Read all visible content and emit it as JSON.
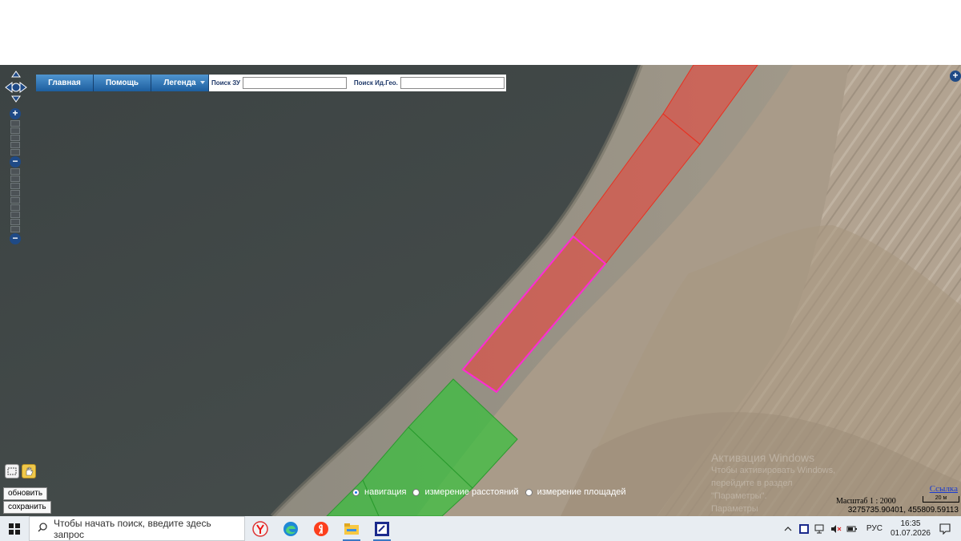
{
  "toolbar": {
    "main_label": "Главная",
    "help_label": "Помощь",
    "legend_label": "Легенда",
    "search_zu_label": "Поиск ЗУ",
    "search_zu_value": "",
    "search_geo_label": "Поиск Ид.Гео.",
    "search_geo_value": ""
  },
  "controls": {
    "zoom_in": "+",
    "zoom_out": "−",
    "zoom_mid": "−",
    "add_layer": "+"
  },
  "actions": {
    "refresh_label": "обновить",
    "save_label": "сохранить"
  },
  "modes": {
    "items": [
      {
        "label": "навигация",
        "selected": true
      },
      {
        "label": "измерение расстояний",
        "selected": false
      },
      {
        "label": "измерение площадей",
        "selected": false
      }
    ]
  },
  "watermark": {
    "line1": "Активация Windows",
    "line2": "Чтобы активировать Windows, перейдите в раздел \"Параметры\".",
    "line3": "Параметры"
  },
  "map_info": {
    "link_label": "Ссылка",
    "scale_text": "Масштаб 1 : 2000",
    "scale_bar_label": "20 м",
    "coordinates": "3275735.90401, 455809.59113"
  },
  "parcels": [
    {
      "id": "red-1",
      "color": "#e8463c",
      "style": "red"
    },
    {
      "id": "red-2",
      "color": "#e8463c",
      "style": "red"
    },
    {
      "id": "red-3",
      "color": "#e8463c",
      "style": "red"
    },
    {
      "id": "selected",
      "color": "#ff2ad4",
      "style": "selected"
    },
    {
      "id": "green-1",
      "color": "#36c23a",
      "style": "green"
    },
    {
      "id": "green-2",
      "color": "#36c23a",
      "style": "green"
    },
    {
      "id": "green-3",
      "color": "#36c23a",
      "style": "green"
    }
  ],
  "taskbar": {
    "search_placeholder": "Чтобы начать поиск, введите здесь запрос",
    "apps": [
      "yandex-browser-icon",
      "edge-icon",
      "yandex-icon",
      "file-explorer-icon",
      "app-icon"
    ],
    "language": "РУС",
    "time": "16:35",
    "date": "01.07.2026"
  }
}
